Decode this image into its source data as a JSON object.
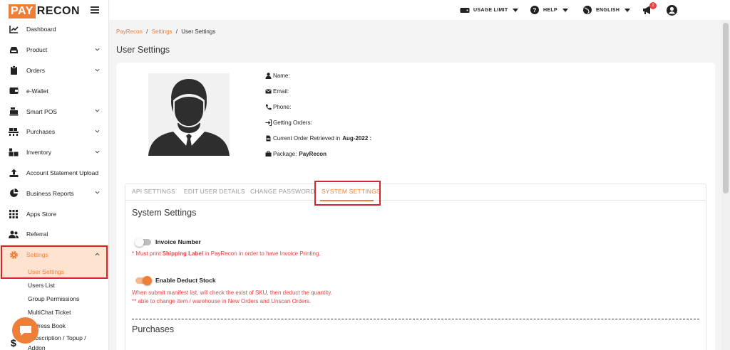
{
  "brand": {
    "part1": "PAY",
    "part2": "RECON",
    "accent": "#ee7f38",
    "highlight": "#d9242b"
  },
  "sidebar": {
    "items": [
      {
        "label": "Dashboard",
        "icon": "chart-line-icon"
      },
      {
        "label": "Product",
        "icon": "inbox-icon",
        "expandable": true
      },
      {
        "label": "Orders",
        "icon": "clipboard-icon",
        "expandable": true
      },
      {
        "label": "e-Wallet",
        "icon": "wallet-icon"
      },
      {
        "label": "Smart POS",
        "icon": "cash-register-icon",
        "expandable": true
      },
      {
        "label": "Purchases",
        "icon": "pallet-icon",
        "expandable": true
      },
      {
        "label": "Inventory",
        "icon": "boxes-icon",
        "expandable": true
      },
      {
        "label": "Account Statement Upload",
        "icon": "upload-icon"
      },
      {
        "label": "Business Reports",
        "icon": "pie-chart-icon",
        "expandable": true
      },
      {
        "label": "Apps Store",
        "icon": "grid-icon"
      },
      {
        "label": "Referral",
        "icon": "users-icon"
      },
      {
        "label": "Settings",
        "icon": "gear-icon",
        "expandable": true,
        "active": true
      }
    ],
    "sub_items": [
      "User Settings",
      "Users List",
      "Group Permissions",
      "MultiChat Ticket",
      "Address Book",
      "Subscription / Topup /",
      "Addon"
    ]
  },
  "topbar": {
    "usage_limit": "USAGE LIMIT",
    "help": "HELP",
    "language": "ENGLISH",
    "notification_count": "2"
  },
  "breadcrumb": {
    "root": "PayRecon",
    "sep1": "/",
    "parent": "Settings",
    "sep2": "/",
    "current": "User Settings"
  },
  "page_title": "User Settings",
  "profile": {
    "name_label": "Name:",
    "email_label": "Email:",
    "phone_label": "Phone:",
    "getting_orders_label": "Getting Orders:",
    "order_retrieved_label": "Current Order Retrieved in",
    "order_retrieved_value": "Aug-2022 :",
    "package_label": "Package:",
    "package_value": "PayRecon"
  },
  "tabs": [
    {
      "label": "API SETTINGS",
      "active": false
    },
    {
      "label": "EDIT USER DETAILS",
      "active": false
    },
    {
      "label": "CHANGE PASSWORD",
      "active": false
    },
    {
      "label": "SYSTEM SETTINGS",
      "active": true
    }
  ],
  "system_settings": {
    "title": "System Settings",
    "invoice": {
      "label": "Invoice Number",
      "enabled": false,
      "note_prefix": "* Must print",
      "note_bold": "Shipping Label",
      "note_suffix": "in PayRecon in order to have Invoice Printing."
    },
    "deduct": {
      "label": "Enable Deduct Stock",
      "enabled": true,
      "note1": "When submit manifest list, will check the exist of SKU, then deduct the quantity.",
      "note2": "** able to change item / warehouse in New Orders and Unscan Orders."
    }
  },
  "purchases_title": "Purchases"
}
